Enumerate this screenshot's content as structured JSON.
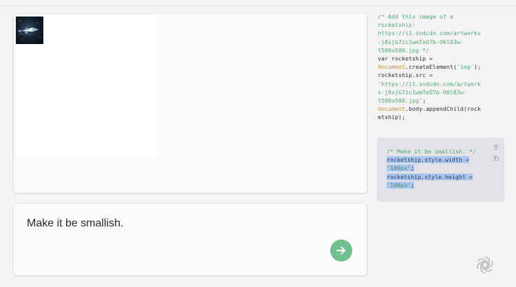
{
  "preview": {
    "image_alt": "rocketship"
  },
  "prompt": {
    "text": "Make it be smallish.",
    "send_icon": "arrow-right-icon"
  },
  "code": {
    "lines": [
      [
        {
          "t": "/* Add this image of a",
          "c": "c-comment"
        }
      ],
      [
        {
          "t": "rocketship:",
          "c": "c-comment"
        }
      ],
      [
        {
          "t": "https://i1.sndcdn.com/artworks",
          "c": "c-comment"
        }
      ],
      [
        {
          "t": "-j8xjG7zc1wmTeO7b-O6l83w-",
          "c": "c-comment"
        }
      ],
      [
        {
          "t": "t500x500.jpg */",
          "c": "c-comment"
        }
      ],
      [
        {
          "t": "var ",
          "c": "c-plain"
        },
        {
          "t": "rocketship",
          "c": "c-plain"
        },
        {
          "t": " =",
          "c": "c-plain"
        }
      ],
      [
        {
          "t": "document",
          "c": "c-orange"
        },
        {
          "t": ".createElement(",
          "c": "c-plain"
        },
        {
          "t": "'img'",
          "c": "c-green"
        },
        {
          "t": ");",
          "c": "c-plain"
        }
      ],
      [
        {
          "t": "rocketship.src =",
          "c": "c-plain"
        }
      ],
      [
        {
          "t": "'https://i1.sndcdn.com/artwork",
          "c": "c-green"
        }
      ],
      [
        {
          "t": "s-j8xjG7zc1wmTeO7b-O6l83w-",
          "c": "c-green"
        }
      ],
      [
        {
          "t": "t500x500.jpg'",
          "c": "c-green"
        },
        {
          "t": ";",
          "c": "c-plain"
        }
      ],
      [
        {
          "t": "document",
          "c": "c-orange"
        },
        {
          "t": ".body.appendChild(rock",
          "c": "c-plain"
        }
      ],
      [
        {
          "t": "etship);",
          "c": "c-plain"
        }
      ]
    ],
    "block": {
      "comment": "/* Make it be smallish. */",
      "width_line": "rocketship.style.width =",
      "width_value": "'100px'",
      "semicolon": ";",
      "height_line": "rocketship.style.height =",
      "height_value": "'100px'",
      "icons": [
        "trash-icon",
        "copy-icon"
      ]
    }
  },
  "logo": "openai-logo-icon",
  "colors": {
    "send_button": "#6ec18f",
    "comment": "#4ea874",
    "keyword_orange": "#c8902f",
    "highlight": "#a9c5f0"
  }
}
